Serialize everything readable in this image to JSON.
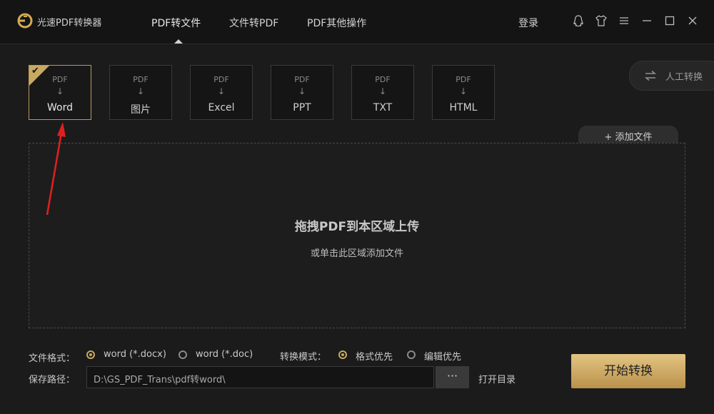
{
  "app": {
    "title": "光速PDF转换器"
  },
  "nav": [
    {
      "label": "PDF转文件",
      "active": true
    },
    {
      "label": "文件转PDF",
      "active": false
    },
    {
      "label": "PDF其他操作",
      "active": false
    }
  ],
  "header": {
    "login_label": "登录",
    "icons": [
      "qq-icon",
      "tshirt-icon",
      "menu-icon",
      "minimize-icon",
      "maximize-icon",
      "close-icon"
    ]
  },
  "manual": {
    "label": "人工转换",
    "icon": "swap-arrows-icon"
  },
  "formats": [
    {
      "top": "PDF",
      "label": "Word",
      "selected": true
    },
    {
      "top": "PDF",
      "label": "图片",
      "selected": false
    },
    {
      "top": "PDF",
      "label": "Excel",
      "selected": false
    },
    {
      "top": "PDF",
      "label": "PPT",
      "selected": false
    },
    {
      "top": "PDF",
      "label": "TXT",
      "selected": false
    },
    {
      "top": "PDF",
      "label": "HTML",
      "selected": false
    }
  ],
  "arrow_glyph": "↓",
  "add_file": {
    "plus": "+",
    "label": "添加文件"
  },
  "dropzone": {
    "title": "拖拽PDF到本区域上传",
    "subtitle": "或单击此区域添加文件"
  },
  "options": {
    "format_label": "文件格式：",
    "format_options": [
      {
        "label": "word (*.docx)",
        "checked": true
      },
      {
        "label": "word (*.doc)",
        "checked": false
      }
    ],
    "mode_label": "转换模式：",
    "mode_options": [
      {
        "label": "格式优先",
        "checked": true
      },
      {
        "label": "编辑优先",
        "checked": false
      }
    ],
    "path_label": "保存路径：",
    "path_value": "D:\\GS_PDF_Trans\\pdf转word\\",
    "browse_label": "···",
    "open_dir_label": "打开目录"
  },
  "start_button": "开始转换",
  "colors": {
    "accent": "#c9a860",
    "background": "#1b1b1b",
    "titlebar": "#141414",
    "annotation": "#e02020"
  }
}
